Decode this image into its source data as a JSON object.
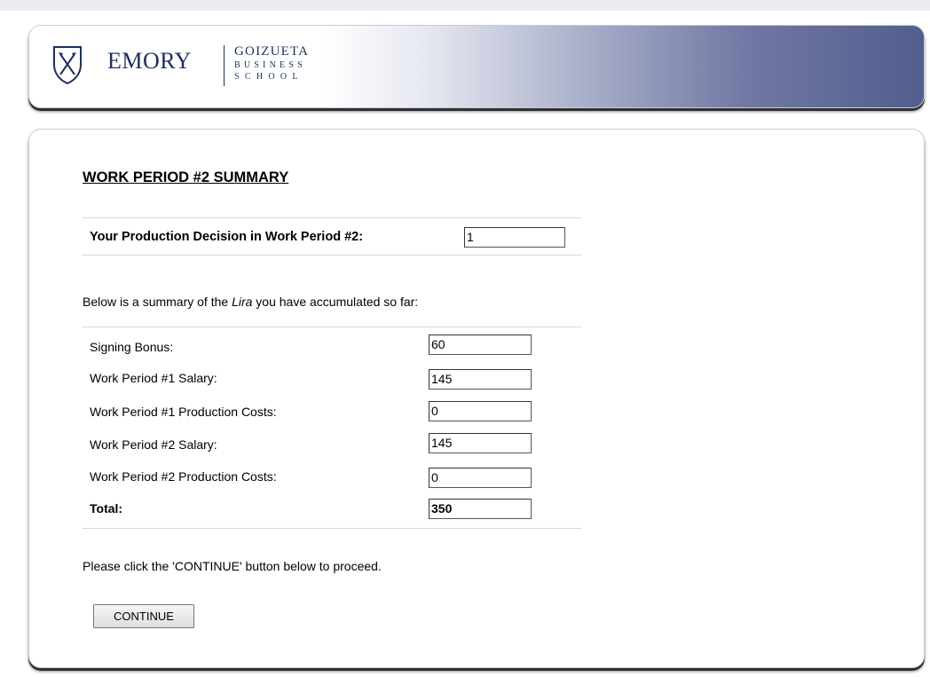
{
  "header": {
    "logo": {
      "emory": "EMORY",
      "goizueta": "GOIZUETA",
      "business": "BUSINESS",
      "school": "SCHOOL"
    }
  },
  "summary": {
    "title": "WORK PERIOD #2 SUMMARY",
    "production_decision_label": "Your Production Decision in Work Period #2:",
    "production_decision_value": "1",
    "intro_prefix": "Below is a summary of the ",
    "intro_emphasis": "Lira",
    "intro_suffix": " you have accumulated so far:",
    "rows": [
      {
        "label": "Signing Bonus:",
        "value": "60"
      },
      {
        "label": "Work Period #1 Salary:",
        "value": "145"
      },
      {
        "label": "Work Period #1 Production Costs:",
        "value": "0"
      },
      {
        "label": "Work Period #2 Salary:",
        "value": "145"
      },
      {
        "label": "Work Period #2 Production Costs:",
        "value": "0"
      },
      {
        "label": "Total:",
        "value": "350"
      }
    ],
    "proceed_text": "Please click the 'CONTINUE' button below to proceed.",
    "continue_label": "CONTINUE"
  },
  "colors": {
    "brand_navy": "#1e2f5e",
    "header_gradient_end": "#535d8e"
  },
  "icons": {
    "logo": "emory-shield-icon"
  }
}
